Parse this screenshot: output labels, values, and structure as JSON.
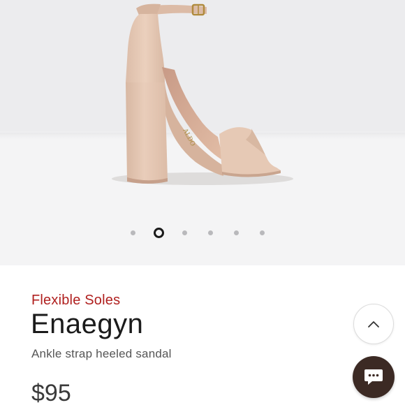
{
  "gallery": {
    "image_alt": "Nude suede ankle strap block heel sandal",
    "pager": {
      "count": 6,
      "active_index": 1
    }
  },
  "product": {
    "feature": "Flexible Soles",
    "name": "Enaegyn",
    "description": "Ankle strap heeled sandal",
    "price": "$95"
  },
  "actions": {
    "scroll_up_icon": "chevron-up-icon",
    "chat_icon": "chat-bubble-icon"
  },
  "colors": {
    "feature_accent": "#b0201f",
    "chat_button": "#3c2a24",
    "suede": "#e3c6b2"
  }
}
